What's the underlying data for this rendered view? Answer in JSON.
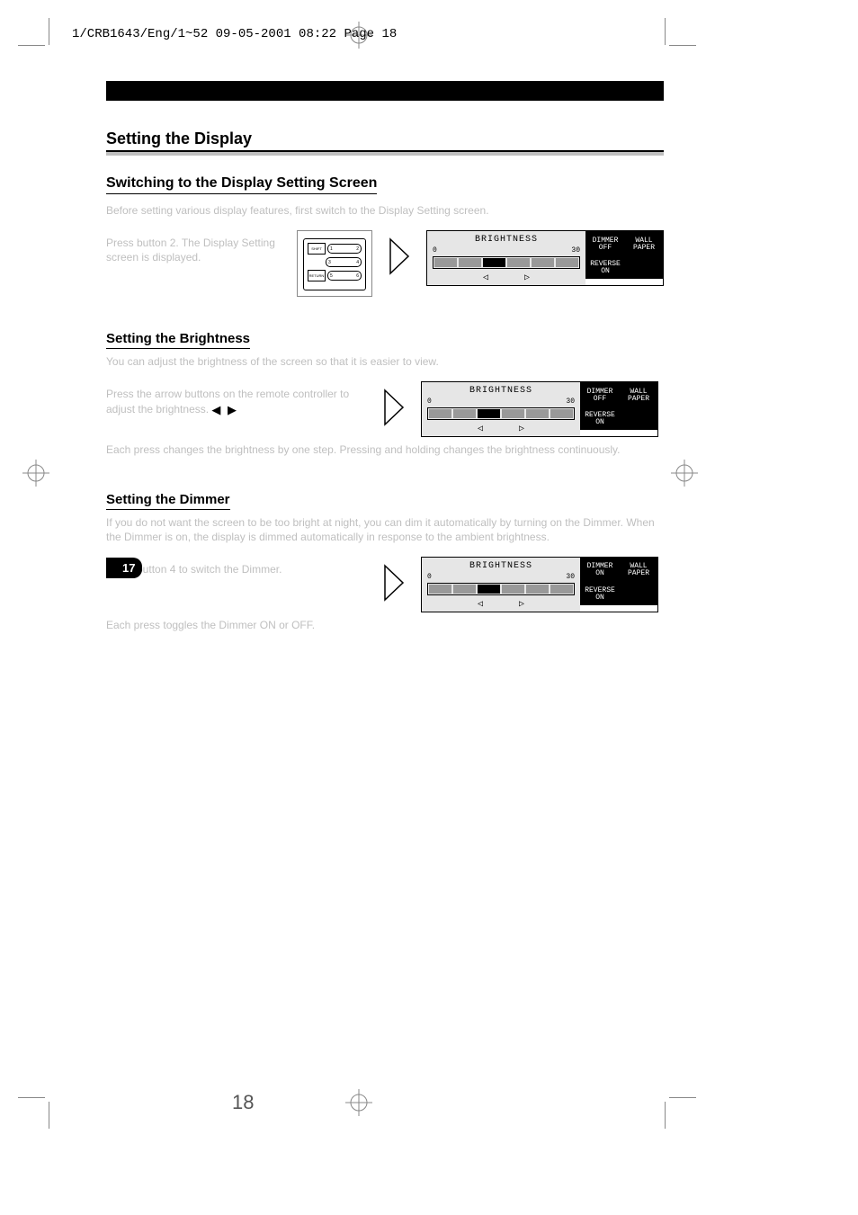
{
  "print": {
    "slug": "1/CRB1643/Eng/1~52  09-05-2001 08:22  Page 18",
    "page_badge": "17",
    "page_num_print": "18"
  },
  "headings": {
    "h1": "Setting the Display",
    "h2": "Switching to the Display Setting Screen",
    "h3a": "Setting the Brightness",
    "h3b": "Setting the Dimmer"
  },
  "text": {
    "switch_intro": "Before setting various display features, first switch to the Display Setting screen.",
    "switch_step": "Press button 2. The Display Setting screen is displayed.",
    "bright_intro": "You can adjust the brightness of the screen so that it is easier to view.",
    "bright_step": "Press the arrow buttons on the remote controller to adjust the brightness.",
    "arrows": "◀ ▶",
    "bright_note": "Each press changes the brightness by one step. Pressing and holding changes the brightness continuously.",
    "dimmer_intro": "If you do not want the screen to be too bright at night, you can dim it automatically by turning on the Dimmer. When the Dimmer is on, the display is dimmed automatically in response to the ambient brightness.",
    "dimmer_step": "Press button 4 to switch the Dimmer.",
    "dimmer_note": "Each press toggles the Dimmer ON or OFF."
  },
  "lcd": {
    "title": "BRIGHTNESS",
    "scale_min": "0",
    "scale_max": "30",
    "left_arrow": "◁",
    "right_arrow": "▷",
    "cells": {
      "dimmer_off_top": "DIMMER",
      "dimmer_off_bot": "OFF",
      "dimmer_on_top": "DIMMER",
      "dimmer_on_bot": "ON",
      "wall_top": "WALL",
      "wall_bot": "PAPER",
      "reverse_top": "REVERSE",
      "reverse_bot": "ON"
    }
  },
  "remote": {
    "shift": "SHIFT",
    "return": "RETURN",
    "b1": "1",
    "b2": "2",
    "b3": "3",
    "b4": "4",
    "b5": "5",
    "b6": "6"
  }
}
